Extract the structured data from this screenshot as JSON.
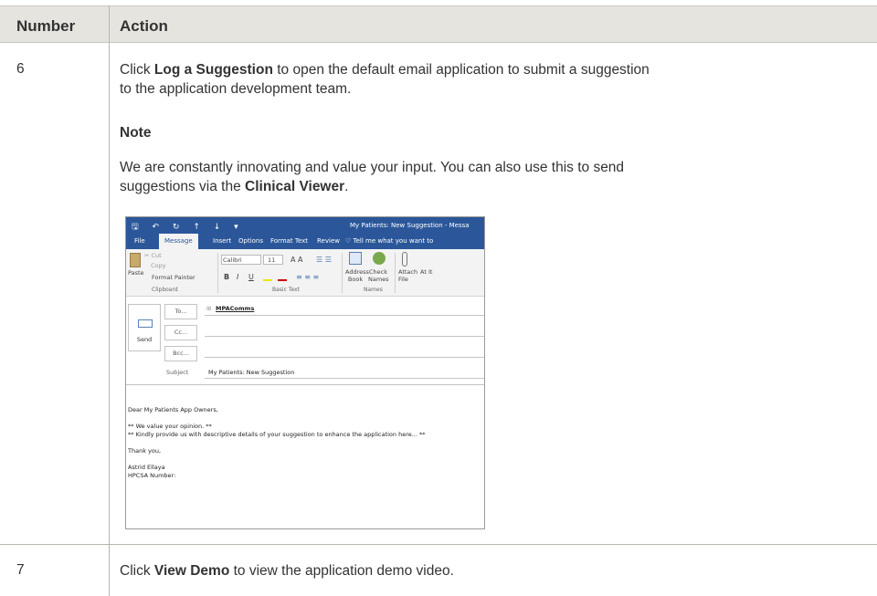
{
  "table": {
    "headers": [
      "Number",
      "Action"
    ],
    "rows": [
      {
        "number": "6",
        "para1_prefix": "Click ",
        "para1_bold": "Log a Suggestion",
        "para1_suffix": " to open the default email application to submit a suggestion",
        "para1_line2": "to the application development team.",
        "note_label": "Note",
        "note_line1": "We are constantly innovating and value your input. You can also use this to send",
        "note_line2_prefix": "suggestions via the ",
        "note_line2_bold": "Clinical Viewer",
        "note_line2_suffix": "."
      },
      {
        "number": "7",
        "text_prefix": "Click ",
        "text_bold": "View Demo",
        "text_suffix": " to view the application demo video."
      }
    ]
  },
  "outlook": {
    "quick_access": "🖫 ↶ ↻ ↑ ↓ ▾",
    "window_title": "My Patients: New Suggestion - Messa",
    "menu": [
      "File",
      "Message",
      "Insert",
      "Options",
      "Format Text",
      "Review",
      "♡ Tell me what you want to"
    ],
    "ribbon": {
      "cut": "✂ Cut",
      "copy": "Copy",
      "paste": "Paste",
      "format_painter": "Format Painter",
      "clipboard": "Clipboard",
      "font_name": "Calibri",
      "font_size": "11",
      "bold": "B",
      "italic": "I",
      "underline": "U",
      "basic_text": "Basic Text",
      "address_book": "Address Book",
      "check_names": "Check Names",
      "names": "Names",
      "attach_file": "Attach File",
      "attach_item": "At It"
    },
    "send_label": "Send",
    "to_label": "To...",
    "cc_label": "Cc...",
    "bcc_label": "Bcc...",
    "to_value": "MPAComms",
    "subject_label": "Subject",
    "subject_value": "My Patients: New Suggestion",
    "body": [
      "Dear My Patients App Owners,",
      "",
      "** We value your opinion. **",
      "** Kindly provide us with descriptive details of your suggestion to enhance the application here... **",
      "",
      "Thank you,",
      "",
      "Astrid Ellaya",
      "HPCSA Number:"
    ]
  }
}
